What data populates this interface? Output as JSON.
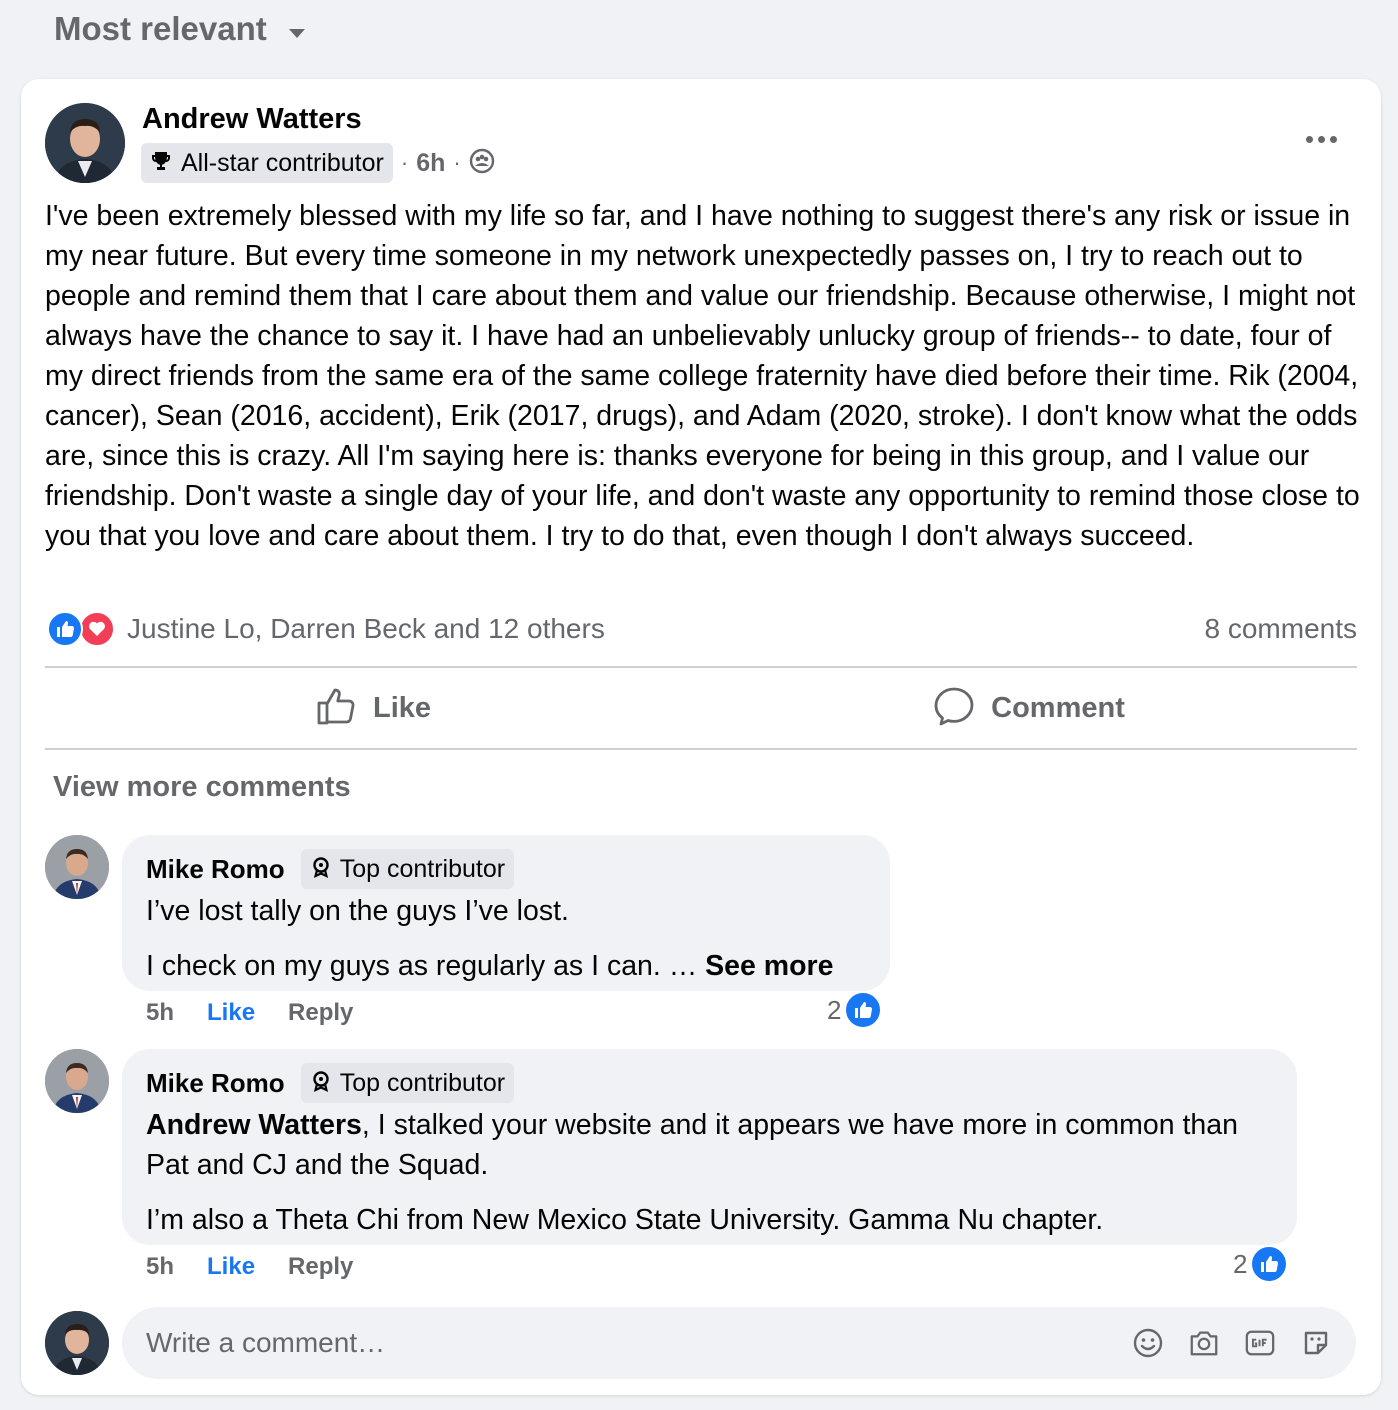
{
  "sort": {
    "label": "Most relevant"
  },
  "post": {
    "author": "Andrew Watters",
    "badge": "All-star contributor",
    "time": "6h",
    "separator": "·",
    "body": "I've been extremely blessed with my life so far, and I have nothing to suggest there's any risk or issue in my near future. But every time someone in my network unexpectedly passes on, I try to reach out to people and remind them that I care about them and value our friendship. Because otherwise, I might not always have the chance to say it. I have had an unbelievably unlucky group of friends-- to date, four of my direct friends from the same era of the same college fraternity have died before their time. Rik (2004, cancer), Sean (2016, accident), Erik (2017, drugs), and Adam (2020, stroke). I don't know what the odds are, since this is crazy. All I'm saying here is: thanks everyone for being in this group, and I value our friendship. Don't waste a single day of your life, and don't waste any opportunity to remind those close to you that you love and care about them. I try to do that, even though I don't always succeed.",
    "reactors": "Justine Lo, Darren Beck and 12 others",
    "comment_count": "8 comments",
    "actions": {
      "like": "Like",
      "comment": "Comment"
    }
  },
  "view_more_comments": "View more comments",
  "comments": [
    {
      "author": "Mike Romo",
      "badge": "Top contributor",
      "line1": "I’ve lost tally on the guys I’ve lost.",
      "line2": "I check on my guys as regularly as I can. … ",
      "see_more": "See more",
      "time": "5h",
      "like": "Like",
      "reply": "Reply",
      "reaction_count": "2"
    },
    {
      "author": "Mike Romo",
      "badge": "Top contributor",
      "mention": "Andrew Watters",
      "line1": ", I stalked your website and it appears we have more in common than Pat and CJ and the Squad.",
      "line2": "I’m also a Theta Chi from New Mexico State University. Gamma Nu chapter.",
      "time": "5h",
      "like": "Like",
      "reply": "Reply",
      "reaction_count": "2"
    }
  ],
  "composer": {
    "placeholder": "Write a comment…",
    "tools": [
      "emoji-icon",
      "camera-icon",
      "gif-icon",
      "sticker-icon"
    ]
  },
  "colors": {
    "accent": "#1877f2",
    "love": "#f33e58",
    "secondary_text": "#65676b",
    "bubble": "#f0f2f5"
  }
}
